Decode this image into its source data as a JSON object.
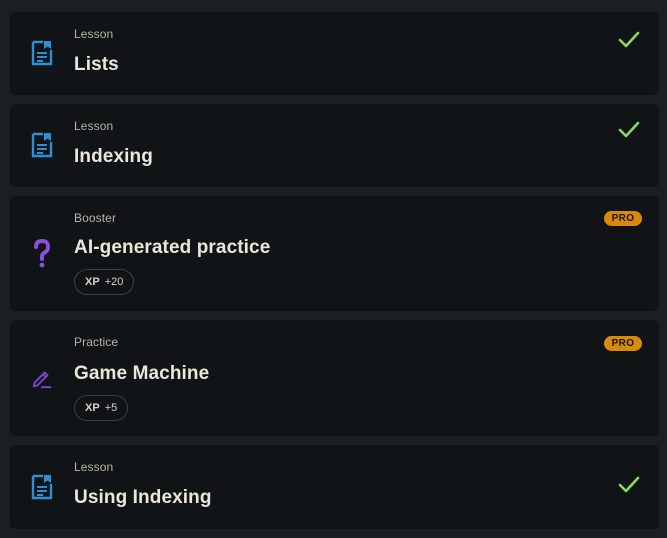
{
  "items": [
    {
      "kind": "Lesson",
      "title": "Lists",
      "icon": "lesson-icon",
      "completed": true
    },
    {
      "kind": "Lesson",
      "title": "Indexing",
      "icon": "lesson-icon",
      "completed": true
    },
    {
      "kind": "Booster",
      "title": "AI-generated practice",
      "icon": "booster-question-icon",
      "badge": "PRO",
      "xp_label": "XP",
      "xp_value": "+20"
    },
    {
      "kind": "Practice",
      "title": "Game Machine",
      "icon": "practice-pencil-icon",
      "badge": "PRO",
      "xp_label": "XP",
      "xp_value": "+5"
    },
    {
      "kind": "Lesson",
      "title": "Using Indexing",
      "icon": "lesson-icon",
      "completed": true
    }
  ],
  "colors": {
    "lesson_icon": "#2e8fd6",
    "booster_icon": "#8b4fd9",
    "practice_icon": "#7a4ad0",
    "check": "#8ad85f",
    "pro_badge": "#d98a0b"
  }
}
